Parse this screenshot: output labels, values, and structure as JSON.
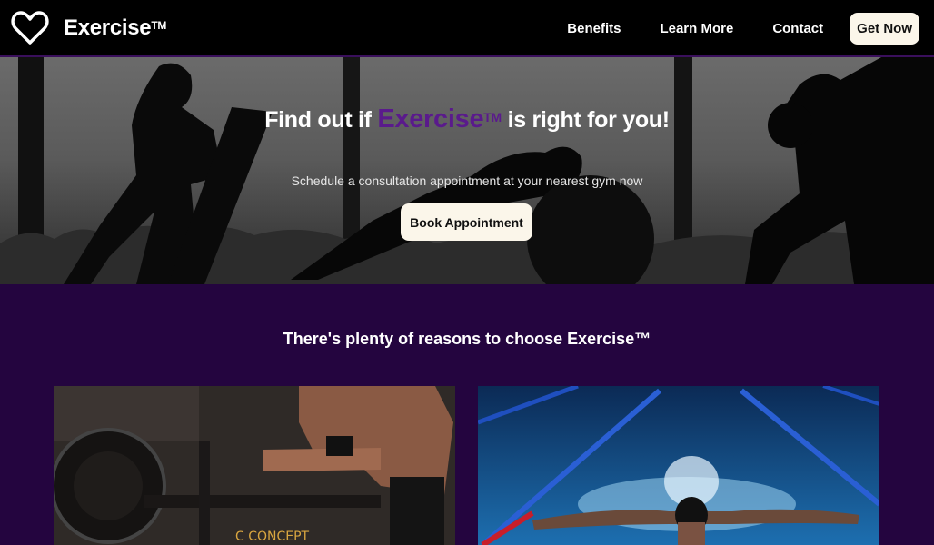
{
  "nav": {
    "logo_icon": "heart-outline-icon",
    "brand": "Exercise",
    "brand_mark": "TM",
    "links": [
      "Benefits",
      "Learn More",
      "Contact"
    ],
    "cta": "Get Now"
  },
  "hero": {
    "title_before": "Find out if",
    "title_brand": "Exercise",
    "title_brand_mark": "TM",
    "title_after": "is right for you!",
    "subtitle": "Schedule a consultation appointment at your nearest gym now",
    "button": "Book Appointment"
  },
  "reasons": {
    "title": "There's plenty of reasons to choose Exercise™",
    "cards": [
      {
        "image": "rowing-machine-photo"
      },
      {
        "image": "swimmer-butterfly-photo"
      }
    ]
  },
  "colors": {
    "nav_bg": "#000000",
    "accent_purple": "#5a1a8c",
    "section_bg": "#24053f",
    "button_bg": "#fbf6ea"
  }
}
